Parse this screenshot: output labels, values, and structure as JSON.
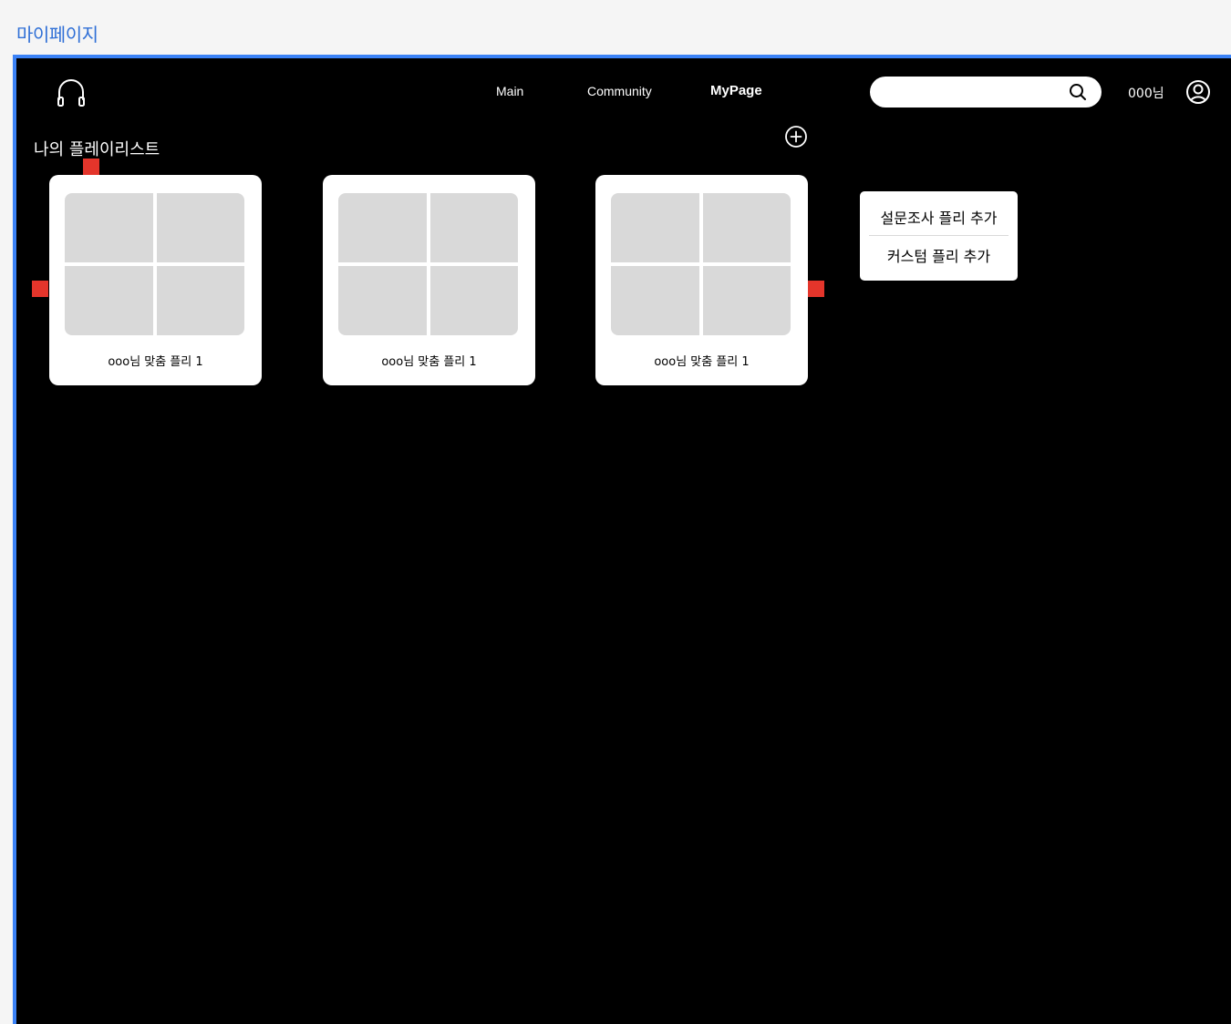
{
  "page": {
    "frame_label": "마이페이지"
  },
  "header": {
    "logo_icon": "headphones-icon",
    "nav": [
      {
        "label": "Main",
        "active": false
      },
      {
        "label": "Community",
        "active": false
      },
      {
        "label": "MyPage",
        "active": true
      }
    ],
    "search": {
      "value": "",
      "placeholder": "",
      "icon": "search-icon"
    },
    "user": {
      "name": "000님",
      "icon": "user-circle-icon"
    }
  },
  "main": {
    "section_title": "나의 플레이리스트",
    "add_icon": "plus-circle-icon",
    "playlists": [
      {
        "title": "ooo님 맞춤 플리 1"
      },
      {
        "title": "ooo님 맞춤 플리 1"
      },
      {
        "title": "ooo님 맞춤 플리 1"
      }
    ],
    "add_menu": {
      "items": [
        {
          "label": "설문조사 플리 추가"
        },
        {
          "label": "커스텀 플리 추가"
        }
      ]
    }
  },
  "colors": {
    "frame_label": "#2f6fd6",
    "frame_border": "#3b82f6",
    "background": "#000000",
    "cover_tile": "#d9d9d9",
    "marker": "#e4352b"
  }
}
